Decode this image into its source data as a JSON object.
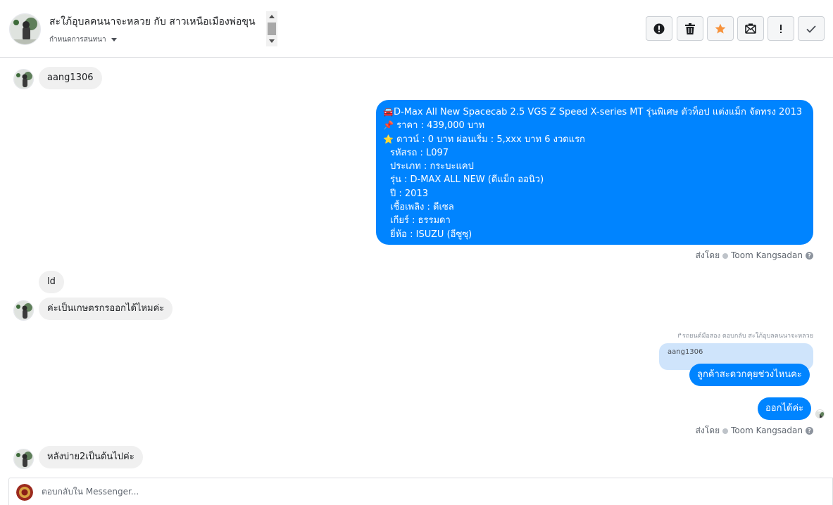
{
  "header": {
    "title": "สะใภ้อุบลคนนาจะหลวย กับ สาวเหนือเมืองพ่อขุน",
    "assign_label": "กำหนดการสนทนา"
  },
  "messages": {
    "m1_text": "aang1306",
    "car_post": {
      "l1": "D-Max All New Spacecab 2.5 VGS Z Speed X-series MT รุ่นพิเศษ ตัวท็อป แต่งแม็ก จัดทรง 2013",
      "l2": "ราคา : 439,000 บาท",
      "l3": "ดาวน์ : 0 บาท ผ่อนเริ่ม : 5,xxx บาท 6 งวดแรก",
      "l4": "รหัสรถ : L097",
      "l5": "ประเภท : กระบะแคป",
      "l6": "รุ่น : D-MAX ALL NEW (ดีแม็ก ออนิว)",
      "l7": "ปี : 2013",
      "l8": "เชื้อเพลิง : ดีเซล",
      "l9": "เกียร์ : ธรรมดา",
      "l10": "ยี่ห้อ : ISUZU (อีซูซุ)"
    },
    "sent_by_prefix": "ส่งโดย",
    "sent_by_name": "Toom Kangsadan",
    "m3_text": "ld",
    "m4_text": "ค่ะเป็นเกษตรกรออกได้ไหมค่ะ",
    "reply_note": "รถยนต์มือสอง ตอบกลับ สะใภ้อุบลคนนาจะหลวย",
    "quoted_text": "aang1306",
    "m5_text": "ลูกค้าสะดวกคุยช่วงไหนคะ",
    "m6_text": "ออกได้ค่ะ",
    "m7_text": "หลังบ่าย2เป็นต้นไปค่ะ"
  },
  "composer": {
    "placeholder": "ตอบกลับใน Messenger..."
  },
  "colors": {
    "outgoing_bubble": "#0084ff",
    "incoming_bubble": "#f0f0f0",
    "quoted_bubble": "#cfe4fb",
    "star_button": "#f7923b"
  },
  "icons": {
    "car_emoji": "🚘",
    "pin_emoji": "📌",
    "star_emoji": "⭐"
  }
}
